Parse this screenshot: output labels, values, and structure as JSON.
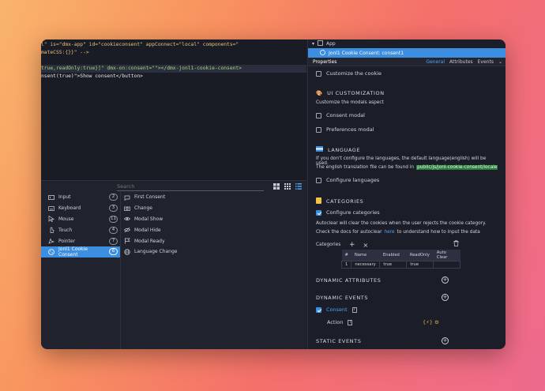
{
  "code": {
    "lines": [
      "l\" is=\"dmx-app\" id=\"cookieconsent\" appConnect=\"local\" components=\"",
      "mateCSS:{}}\" -->",
      "",
      "true,readOnly:true}]\" dmx-on:consent=\"\"></dmx-jonl1-cookie-consent>",
      "nsent(true)\">Show consent</button>"
    ]
  },
  "components": {
    "search_placeholder": "Search",
    "categories": [
      {
        "label": "Input",
        "count": "2",
        "icon": "input-icon"
      },
      {
        "label": "Keyboard",
        "count": "3",
        "icon": "keyboard-icon"
      },
      {
        "label": "Mouse",
        "count": "11",
        "icon": "mouse-icon"
      },
      {
        "label": "Touch",
        "count": "4",
        "icon": "touch-icon"
      },
      {
        "label": "Pointer",
        "count": "7",
        "icon": "pointer-icon"
      },
      {
        "label": "Jonl1 Cookie Consent",
        "count": "6",
        "icon": "cookie-icon"
      }
    ],
    "events": [
      {
        "label": "First Consent",
        "icon": "first-consent-icon"
      },
      {
        "label": "Change",
        "icon": "change-icon"
      },
      {
        "label": "Modal Show",
        "icon": "eye-icon"
      },
      {
        "label": "Modal Hide",
        "icon": "eye-off-icon"
      },
      {
        "label": "Modal Ready",
        "icon": "flag-icon"
      },
      {
        "label": "Language Change",
        "icon": "globe-icon"
      }
    ]
  },
  "properties": {
    "crumb_app": "App",
    "crumb_component": "Jonl1 Cookie Consent: consent1",
    "title": "Properties",
    "tabs": [
      "General",
      "Attributes",
      "Events"
    ],
    "customize_cookie": "Customize the cookie",
    "ui_heading": "UI CUSTOMIZATION",
    "ui_desc": "Customize the modals aspect",
    "consent_modal": "Consent modal",
    "preferences_modal": "Preferences modal",
    "lang_heading": "LANGUAGE",
    "lang_desc1": "If you don't configure the languages, the default language(english) will be used.",
    "lang_desc2": "The english translation file can be found in",
    "lang_path": "public/js/jonl-cookie-consent/locale",
    "configure_languages": "Configure languages",
    "cat_heading": "CATEGORIES",
    "configure_categories": "Configure categories",
    "autoclear1": "Autoclear will clear the cookies when the user rejects the cookie category.",
    "autoclear2a": "Check the docs for autoclear",
    "autoclear_link": "here",
    "autoclear2b": "to understand how to input the data",
    "categories_label": "Categories",
    "table": {
      "headers": [
        "#",
        "Name",
        "Enabled",
        "ReadOnly",
        "Auto Clear"
      ],
      "rows": [
        [
          "1",
          "necessary",
          "true",
          "true",
          ""
        ]
      ]
    },
    "dyn_attr_heading": "DYNAMIC ATTRIBUTES",
    "dyn_events_heading": "DYNAMIC EVENTS",
    "consent_label": "Consent",
    "action_label": "Action",
    "static_events_heading": "STATIC EVENTS"
  },
  "colors": {
    "accent": "#3b8ee0",
    "path_highlight": "#2a7d3a"
  }
}
